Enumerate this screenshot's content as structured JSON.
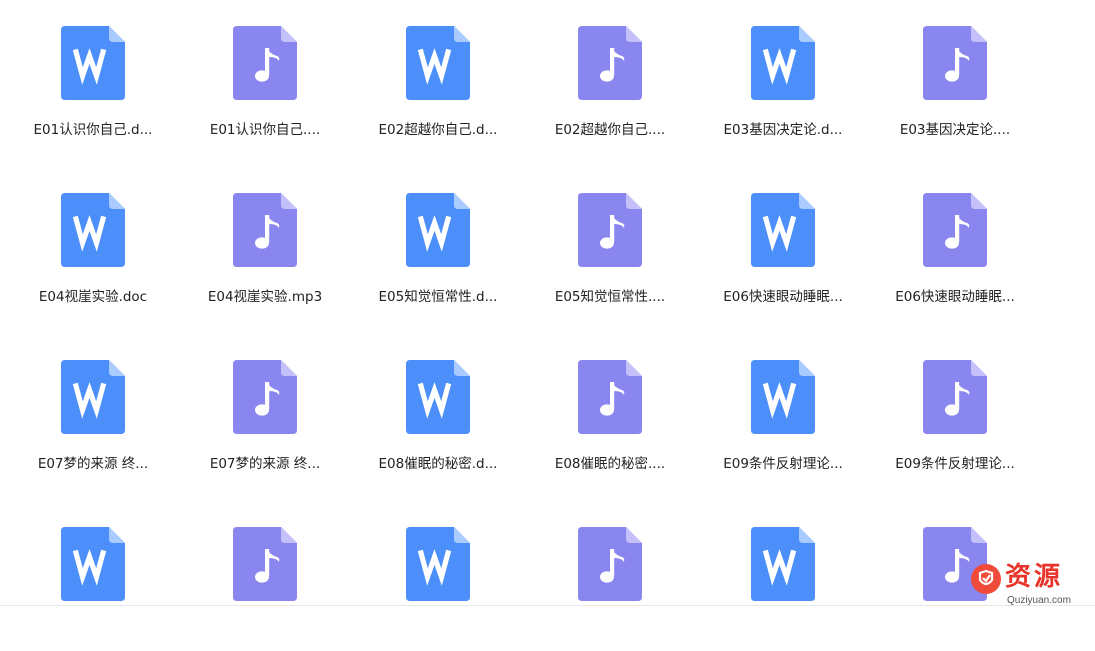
{
  "colors": {
    "doc_icon": "#4c8ffb",
    "doc_fold": "#a9cbff",
    "audio_icon": "#8a86f0",
    "audio_fold": "#c4c1fa",
    "watermark": "#e8342a"
  },
  "files": [
    {
      "name": "E01认识你自己.d...",
      "type": "doc",
      "icon": "word-doc-icon"
    },
    {
      "name": "E01认识你自己....",
      "type": "audio",
      "icon": "music-note-icon"
    },
    {
      "name": "E02超越你自己.d...",
      "type": "doc",
      "icon": "word-doc-icon"
    },
    {
      "name": "E02超越你自己....",
      "type": "audio",
      "icon": "music-note-icon"
    },
    {
      "name": "E03基因决定论.d...",
      "type": "doc",
      "icon": "word-doc-icon"
    },
    {
      "name": "E03基因决定论....",
      "type": "audio",
      "icon": "music-note-icon"
    },
    {
      "name": "E04视崖实验.doc",
      "type": "doc",
      "icon": "word-doc-icon"
    },
    {
      "name": "E04视崖实验.mp3",
      "type": "audio",
      "icon": "music-note-icon"
    },
    {
      "name": "E05知觉恒常性.d...",
      "type": "doc",
      "icon": "word-doc-icon"
    },
    {
      "name": "E05知觉恒常性....",
      "type": "audio",
      "icon": "music-note-icon"
    },
    {
      "name": "E06快速眼动睡眠...",
      "type": "doc",
      "icon": "word-doc-icon"
    },
    {
      "name": "E06快速眼动睡眠...",
      "type": "audio",
      "icon": "music-note-icon"
    },
    {
      "name": "E07梦的来源 终...",
      "type": "doc",
      "icon": "word-doc-icon"
    },
    {
      "name": "E07梦的来源 终...",
      "type": "audio",
      "icon": "music-note-icon"
    },
    {
      "name": "E08催眠的秘密.d...",
      "type": "doc",
      "icon": "word-doc-icon"
    },
    {
      "name": "E08催眠的秘密....",
      "type": "audio",
      "icon": "music-note-icon"
    },
    {
      "name": "E09条件反射理论...",
      "type": "doc",
      "icon": "word-doc-icon"
    },
    {
      "name": "E09条件反射理论...",
      "type": "audio",
      "icon": "music-note-icon"
    },
    {
      "name": "",
      "type": "doc",
      "icon": "word-doc-icon"
    },
    {
      "name": "",
      "type": "audio",
      "icon": "music-note-icon"
    },
    {
      "name": "",
      "type": "doc",
      "icon": "word-doc-icon"
    },
    {
      "name": "",
      "type": "audio",
      "icon": "music-note-icon"
    },
    {
      "name": "",
      "type": "doc",
      "icon": "word-doc-icon"
    },
    {
      "name": "",
      "type": "audio",
      "icon": "music-note-icon"
    }
  ],
  "watermark": {
    "text": "资源",
    "sub": "Quziyuan.com",
    "icon": "logo-badge-icon"
  }
}
